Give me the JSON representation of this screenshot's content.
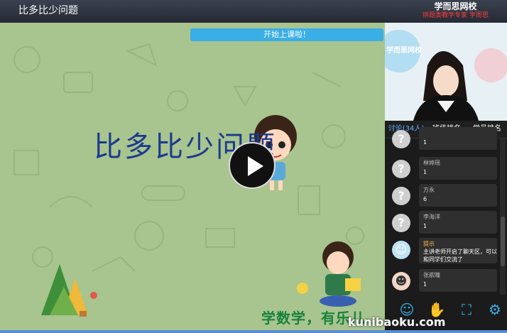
{
  "header": {
    "lesson_title": "比多比少问题",
    "brand_name": "学而思网校",
    "brand_slogan": "拼题类教学专家 学而思"
  },
  "stage": {
    "notice": "开始上课啦！",
    "slide_title": "比多比少问题",
    "slogan": "学数学，有乐儿",
    "badge": "学而思网校"
  },
  "camera": {
    "backdrop_logo": "学而思网校"
  },
  "tabs": [
    {
      "label": "讨论",
      "count": "(34人)"
    },
    {
      "label": "班级排名"
    },
    {
      "label": "学员排名"
    }
  ],
  "chat": [
    {
      "user": "",
      "text": "1"
    },
    {
      "user": "林婷瑶",
      "text": "1"
    },
    {
      "user": "方永",
      "text": "6"
    },
    {
      "user": "李海洋",
      "text": "1"
    },
    {
      "user": "提示",
      "text": "主讲老师开启了聊天区，可以和同学们交流了"
    },
    {
      "user": "张歆瞳",
      "text": "1"
    }
  ],
  "watermark": "kunibaoku.com",
  "colors": {
    "accent": "#3aaee6",
    "slide_bg": "#a8c48f",
    "title": "#1b3a8e",
    "tip": "#ffb84d"
  }
}
